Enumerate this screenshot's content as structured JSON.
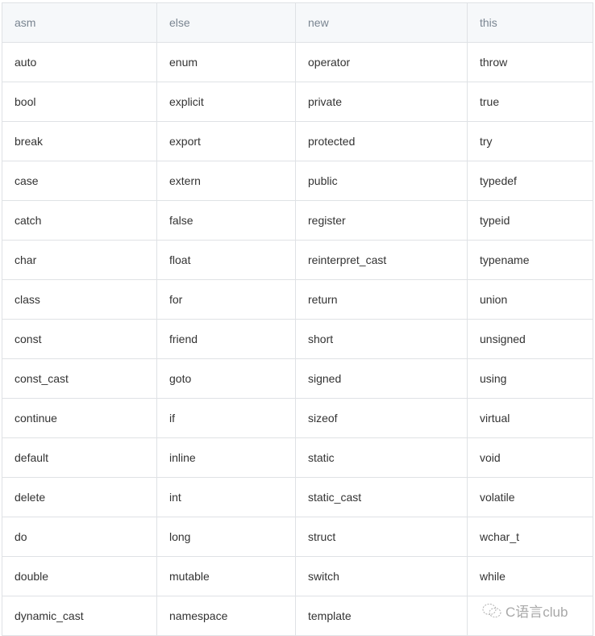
{
  "table": {
    "headers": [
      "asm",
      "else",
      "new",
      "this"
    ],
    "rows": [
      [
        "auto",
        "enum",
        "operator",
        "throw"
      ],
      [
        "bool",
        "explicit",
        "private",
        "true"
      ],
      [
        "break",
        "export",
        "protected",
        "try"
      ],
      [
        "case",
        "extern",
        "public",
        "typedef"
      ],
      [
        "catch",
        "false",
        "register",
        "typeid"
      ],
      [
        "char",
        "float",
        "reinterpret_cast",
        "typename"
      ],
      [
        "class",
        "for",
        "return",
        "union"
      ],
      [
        "const",
        "friend",
        "short",
        "unsigned"
      ],
      [
        "const_cast",
        "goto",
        "signed",
        "using"
      ],
      [
        "continue",
        "if",
        "sizeof",
        "virtual"
      ],
      [
        "default",
        "inline",
        "static",
        "void"
      ],
      [
        "delete",
        "int",
        "static_cast",
        "volatile"
      ],
      [
        "do",
        "long",
        "struct",
        "wchar_t"
      ],
      [
        "double",
        "mutable",
        "switch",
        "while"
      ],
      [
        "dynamic_cast",
        "namespace",
        "template",
        ""
      ]
    ]
  },
  "watermark": {
    "text": "C语言club",
    "icon": "wechat-icon"
  }
}
